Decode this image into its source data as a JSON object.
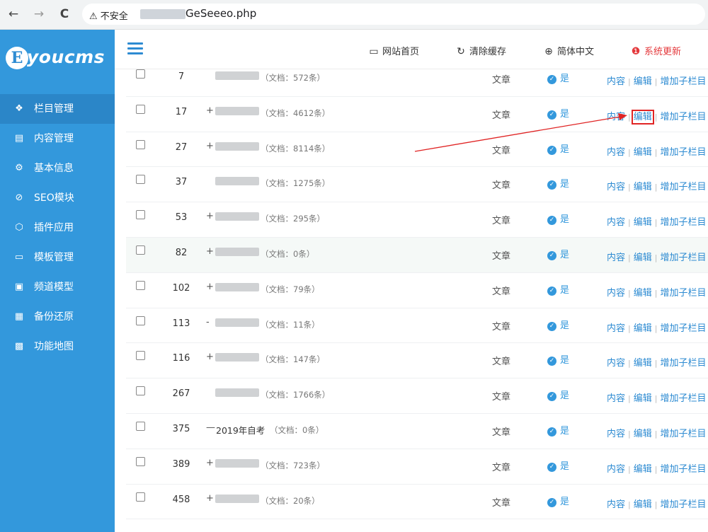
{
  "browser": {
    "back_icon": "←",
    "forward_icon": "→",
    "reload_icon": "C",
    "security_warning": "不安全",
    "url_visible": "GeSeeeo.php"
  },
  "sidebar": {
    "logo_letter": "E",
    "logo_text": "youcms",
    "items": [
      {
        "label": "栏目管理",
        "icon": "layers-icon",
        "glyph": "❖",
        "active": true
      },
      {
        "label": "内容管理",
        "icon": "document-icon",
        "glyph": "▤",
        "active": false
      },
      {
        "label": "基本信息",
        "icon": "gear-icon",
        "glyph": "⚙",
        "active": false
      },
      {
        "label": "SEO模块",
        "icon": "seo-icon",
        "glyph": "⊘",
        "active": false
      },
      {
        "label": "插件应用",
        "icon": "plugin-icon",
        "glyph": "⬡",
        "active": false
      },
      {
        "label": "模板管理",
        "icon": "monitor-icon",
        "glyph": "▭",
        "active": false
      },
      {
        "label": "频道模型",
        "icon": "tv-icon",
        "glyph": "▣",
        "active": false
      },
      {
        "label": "备份还原",
        "icon": "backup-icon",
        "glyph": "▦",
        "active": false
      },
      {
        "label": "功能地图",
        "icon": "grid-icon",
        "glyph": "▩",
        "active": false
      }
    ]
  },
  "header": {
    "items": [
      {
        "label": "网站首页",
        "icon": "monitor-icon",
        "glyph": "▭"
      },
      {
        "label": "清除缓存",
        "icon": "refresh-icon",
        "glyph": "↻"
      },
      {
        "label": "简体中文",
        "icon": "globe-icon",
        "glyph": "⊕"
      },
      {
        "label": "系统更新",
        "icon": "alert-icon",
        "glyph": "❶"
      }
    ]
  },
  "table": {
    "type_label": "文章",
    "show_label": "是",
    "op_content": "内容",
    "op_edit": "编辑",
    "op_add_child": "增加子栏目",
    "rows": [
      {
        "id": "7",
        "tree": "",
        "name": "",
        "count": "（文档：572条）"
      },
      {
        "id": "17",
        "tree": "+",
        "name": "",
        "count": "（文档：4612条）"
      },
      {
        "id": "27",
        "tree": "+",
        "name": "",
        "count": "（文档：8114条）"
      },
      {
        "id": "37",
        "tree": "",
        "name": "",
        "count": "（文档：1275条）"
      },
      {
        "id": "53",
        "tree": "+",
        "name": "",
        "count": "（文档：295条）"
      },
      {
        "id": "82",
        "tree": "+",
        "name": "",
        "count": "（文档：0条）"
      },
      {
        "id": "102",
        "tree": "+",
        "name": "",
        "count": "（文档：79条）"
      },
      {
        "id": "113",
        "tree": "-",
        "name": "",
        "count": "（文档：11条）"
      },
      {
        "id": "116",
        "tree": "+",
        "name": "",
        "count": "（文档：147条）"
      },
      {
        "id": "267",
        "tree": "",
        "name": "",
        "count": "（文档：1766条）"
      },
      {
        "id": "375",
        "tree": "—",
        "name": "2019年自考",
        "count": "（文档：0条）"
      },
      {
        "id": "389",
        "tree": "+",
        "name": "",
        "count": "（文档：723条）"
      },
      {
        "id": "458",
        "tree": "+",
        "name": "",
        "count": "（文档：20条）"
      }
    ]
  },
  "colors": {
    "sidebar_bg": "#3398dc",
    "sidebar_active": "#2b86c8",
    "link": "#2d8bd2",
    "alert": "#e4393c",
    "annotation": "#e02424"
  }
}
